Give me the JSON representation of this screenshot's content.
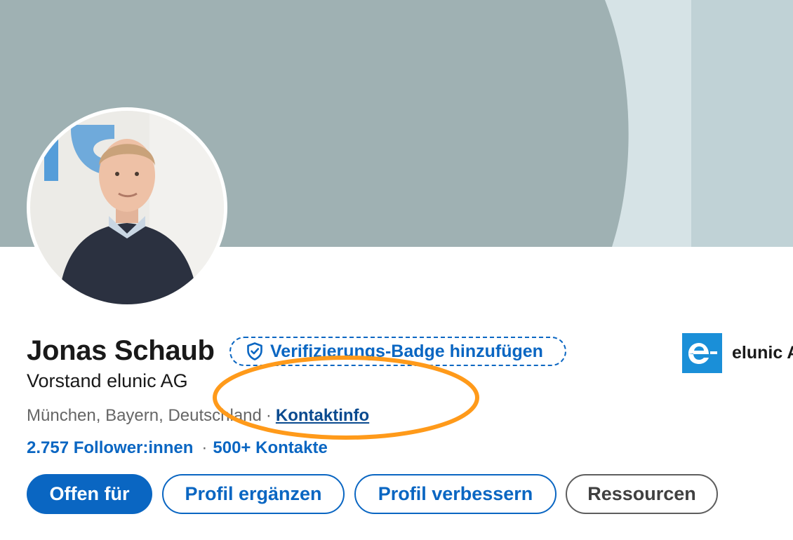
{
  "profile": {
    "name": "Jonas Schaub",
    "headline": "Vorstand elunic AG",
    "location": "München, Bayern, Deutschland",
    "separator": "·",
    "contact_info_label": "Kontaktinfo",
    "followers_label": "2.757 Follower:innen",
    "connections_label": "500+ Kontakte"
  },
  "verification": {
    "label": "Verifizierungs-Badge hinzufügen",
    "icon": "shield-check-icon"
  },
  "company": {
    "name": "elunic A",
    "logo_icon": "elunic-logo"
  },
  "actions": {
    "open_to": "Offen für",
    "complete_profile": "Profil ergänzen",
    "improve_profile": "Profil verbessern",
    "resources": "Ressourcen"
  },
  "colors": {
    "accent": "#0a66c2",
    "banner": "#9fb1b3",
    "annotation": "#ff9a1a"
  }
}
